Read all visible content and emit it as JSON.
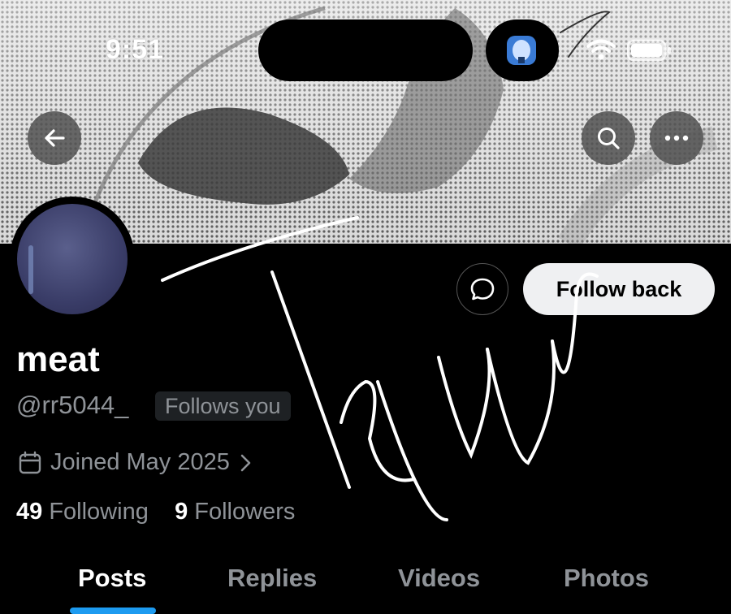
{
  "status_bar": {
    "time": "9:51"
  },
  "header": {
    "back_icon": "arrow-left-icon",
    "search_icon": "search-icon",
    "more_icon": "more-horizontal-icon"
  },
  "profile": {
    "name": "meat",
    "handle": "@rr5044_",
    "follows_you_badge": "Follows you",
    "joined": "Joined May 2025",
    "following_count": "49",
    "following_label": "Following",
    "followers_count": "9",
    "followers_label": "Followers"
  },
  "actions": {
    "message_icon": "message-bubble-icon",
    "follow_back_label": "Follow back"
  },
  "tabs": [
    {
      "label": "Posts",
      "active": true
    },
    {
      "label": "Replies",
      "active": false
    },
    {
      "label": "Videos",
      "active": false
    },
    {
      "label": "Photos",
      "active": false
    }
  ],
  "colors": {
    "accent": "#1d9bf0",
    "muted_text": "#8f9398",
    "background": "#000000"
  }
}
